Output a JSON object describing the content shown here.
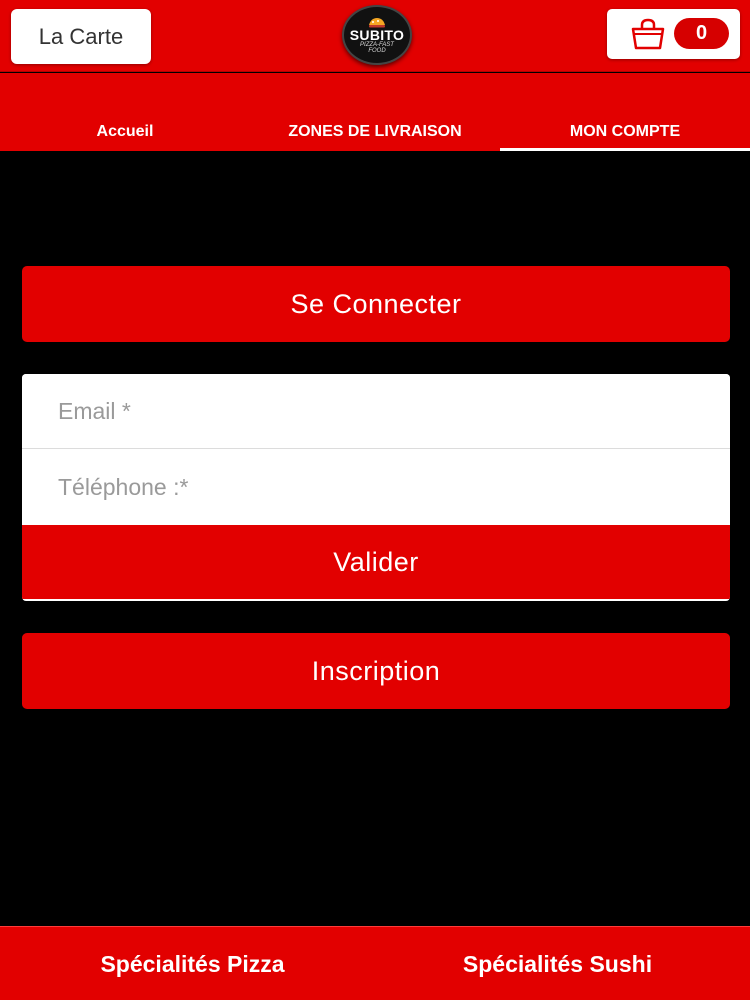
{
  "header": {
    "menu_label": "La Carte",
    "logo": {
      "name": "SUBITO",
      "tagline": "PIZZA-FAST FOOD"
    },
    "cart": {
      "icon": "shopping-bag-icon",
      "count": "0"
    }
  },
  "nav": {
    "tabs": [
      {
        "label": "Accueil",
        "active": false
      },
      {
        "label": "ZONES DE LIVRAISON",
        "active": false
      },
      {
        "label": "MON COMPTE",
        "active": true
      }
    ]
  },
  "main": {
    "connect_label": "Se Connecter",
    "form": {
      "email_placeholder": "Email *",
      "phone_placeholder": "Téléphone :*",
      "submit_label": "Valider"
    },
    "inscription_label": "Inscription"
  },
  "footer": {
    "items": [
      {
        "label": "Spécialités Pizza"
      },
      {
        "label": "Spécialités Sushi"
      }
    ]
  },
  "colors": {
    "brand_red": "#e20000",
    "background": "#000000",
    "text_on_red": "#ffffff"
  }
}
